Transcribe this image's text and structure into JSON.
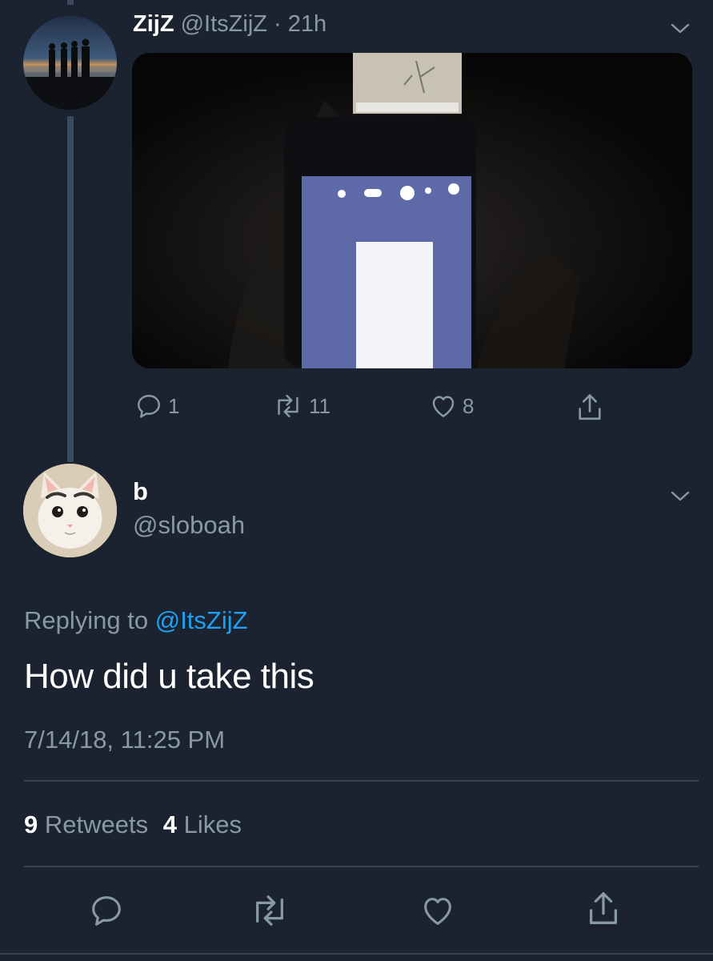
{
  "original_tweet": {
    "display_name": "ZijZ",
    "handle": "@ItsZijZ",
    "separator": "·",
    "time_ago": "21h",
    "avatar": "silhouettes-at-sunset-avatar",
    "media": "dark-photo-of-phone-screen",
    "actions": {
      "replies": "1",
      "retweets": "11",
      "likes": "8"
    }
  },
  "reply_tweet": {
    "display_name": "b",
    "handle": "@sloboah",
    "avatar": "cat-avatar",
    "replying_prefix": "Replying to",
    "replying_handle": "@ItsZijZ",
    "text": "How did u take this",
    "timestamp": "7/14/18, 11:25 PM",
    "stats": {
      "retweets_count": "9",
      "retweets_label": "Retweets",
      "likes_count": "4",
      "likes_label": "Likes"
    }
  },
  "icons": {
    "reply": "reply-icon",
    "retweet": "retweet-icon",
    "like": "heart-icon",
    "share": "share-icon",
    "menu": "chevron-down-icon"
  },
  "colors": {
    "background": "#1b2330",
    "text_primary": "#ffffff",
    "text_muted": "#8899a6",
    "link": "#1da1f2",
    "divider": "#38444d"
  }
}
